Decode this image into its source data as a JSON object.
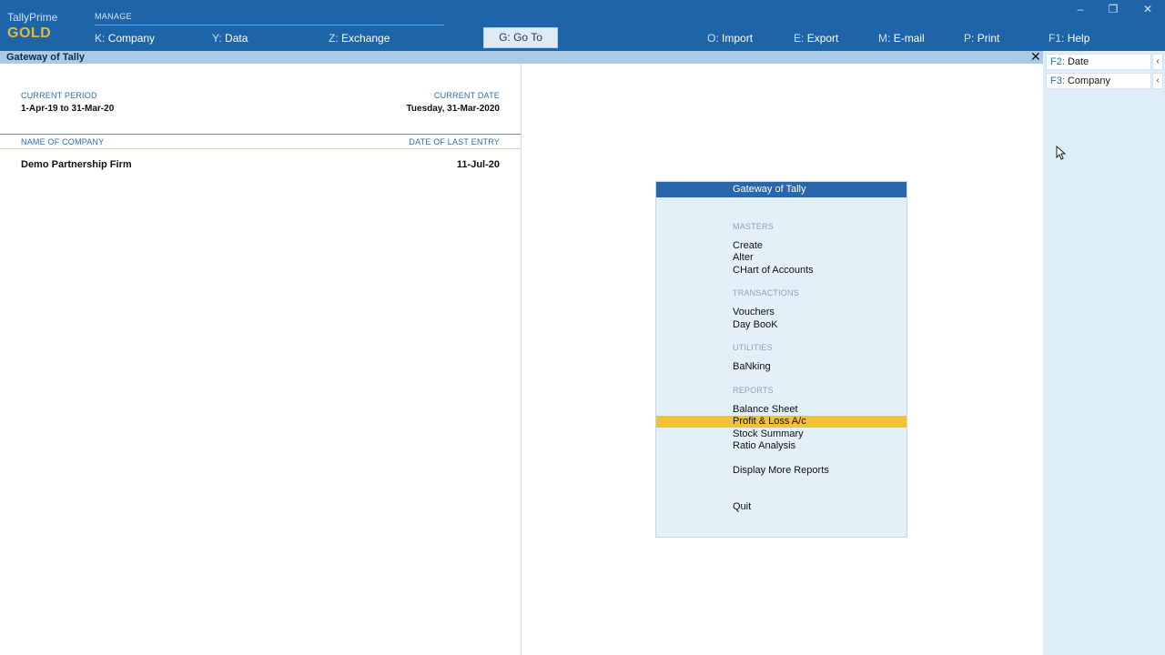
{
  "brand": {
    "name": "TallyPrime",
    "edition": "GOLD"
  },
  "topbar": {
    "manage_label": "MANAGE",
    "menu": [
      {
        "key": "K:",
        "label": "Company"
      },
      {
        "key": "Y:",
        "label": "Data"
      },
      {
        "key": "Z:",
        "label": "Exchange"
      },
      {
        "key": "G:",
        "label": "Go To"
      },
      {
        "key": "O:",
        "label": "Import"
      },
      {
        "key": "E:",
        "label": "Export"
      },
      {
        "key": "M:",
        "label": "E-mail"
      },
      {
        "key": "P:",
        "label": "Print"
      },
      {
        "key": "F1:",
        "label": "Help"
      }
    ],
    "window_controls": [
      "–",
      "❐",
      "✕"
    ]
  },
  "title_strip": {
    "title": "Gateway of Tally",
    "close": "✕"
  },
  "left_pane": {
    "current_period_label": "CURRENT PERIOD",
    "current_period_value": "1-Apr-19 to 31-Mar-20",
    "current_date_label": "CURRENT DATE",
    "current_date_value": "Tuesday, 31-Mar-2020",
    "col_company": "NAME OF COMPANY",
    "col_last_entry": "DATE OF LAST ENTRY",
    "company_name": "Demo Partnership Firm",
    "last_entry_date": "11-Jul-20"
  },
  "gateway": {
    "header": "Gateway of Tally",
    "masters_label": "MASTERS",
    "create": "Create",
    "alter": "Alter",
    "chart_of_accounts": "CHart of Accounts",
    "transactions_label": "TRANSACTIONS",
    "vouchers": "Vouchers",
    "day_book": "Day BooK",
    "utilities_label": "UTILITIES",
    "banking": "BaNking",
    "reports_label": "REPORTS",
    "balance_sheet": "Balance Sheet",
    "profit_loss": "Profit & Loss A/c",
    "stock_summary": "Stock Summary",
    "ratio_analysis": "Ratio Analysis",
    "display_more": "Display More Reports",
    "quit": "Quit",
    "selected_item": "Profit & Loss A/c"
  },
  "sidebar": {
    "date_key": "F2:",
    "date_label": "Date",
    "company_key": "F3:",
    "company_label": "Company",
    "arrow": "‹"
  },
  "colors": {
    "topbar": "#1e64a8",
    "highlight": "#f3c233",
    "card_bg": "#e4f0f8",
    "sidebar_bg": "#ddeef9",
    "brand_gold": "#e9b63a"
  }
}
